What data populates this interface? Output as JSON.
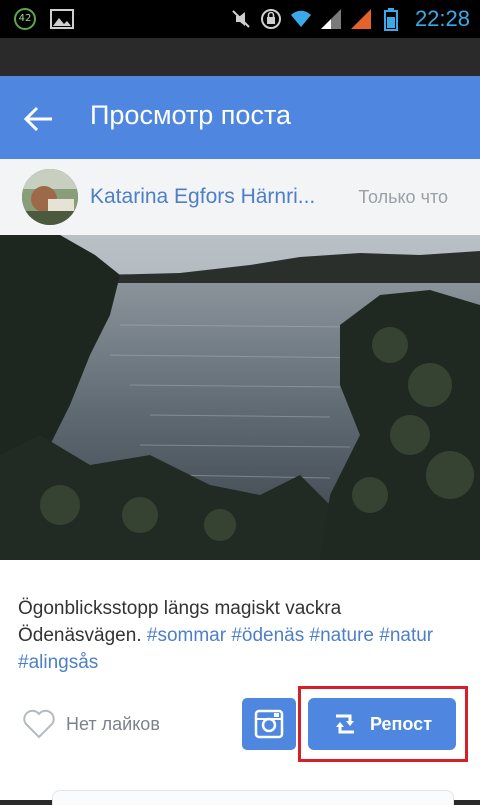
{
  "status_bar": {
    "notification_count": "42",
    "time": "22:28",
    "icons": [
      "notification-badge-icon",
      "gallery-icon",
      "mute-icon",
      "rotation-lock-icon",
      "wifi-icon",
      "signal-icon",
      "signal-icon",
      "battery-icon"
    ]
  },
  "app_bar": {
    "title": "Просмотр поста",
    "back_icon": "back-arrow-icon",
    "color": "#4e86e0"
  },
  "post": {
    "author": "Katarina Egfors Härnri...",
    "time": "Только что",
    "caption_text": "Ögonblicksstopp längs magiskt vackra Ödenäsvägen.",
    "hashtags": [
      "#sommar",
      "#ödenäs",
      "#nature",
      "#natur",
      "#alingsås"
    ],
    "likes_label": "Нет лайков",
    "repost_label": "Репост",
    "instagram_icon": "instagram-icon",
    "repost_icon": "repost-icon"
  },
  "colors": {
    "accent": "#4e86e0",
    "link": "#4d7fc8",
    "highlight": "#d5202a"
  }
}
